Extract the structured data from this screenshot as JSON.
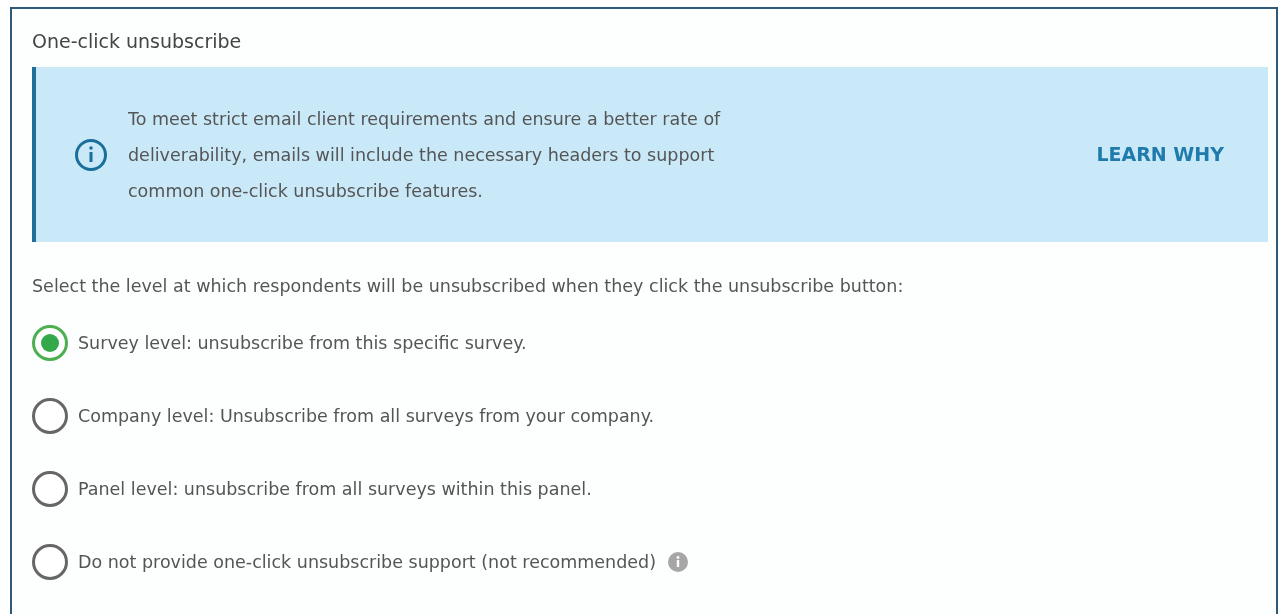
{
  "section": {
    "title": "One-click unsubscribe"
  },
  "notice": {
    "text": "To meet strict email client requirements and ensure a better rate of deliverability, emails will include the necessary headers to support common one-click unsubscribe features.",
    "link": "LEARN WHY"
  },
  "prompt": "Select the level at which respondents will be unsubscribed when they click the unsubscribe button:",
  "options": [
    {
      "label": "Survey level: unsubscribe from this specific survey.",
      "selected": true,
      "info": false
    },
    {
      "label": "Company level: Unsubscribe from all surveys from your company.",
      "selected": false,
      "info": false
    },
    {
      "label": "Panel level: unsubscribe from all surveys within this panel.",
      "selected": false,
      "info": false
    },
    {
      "label": "Do not provide one-click unsubscribe support (not recommended)",
      "selected": false,
      "info": true
    }
  ]
}
